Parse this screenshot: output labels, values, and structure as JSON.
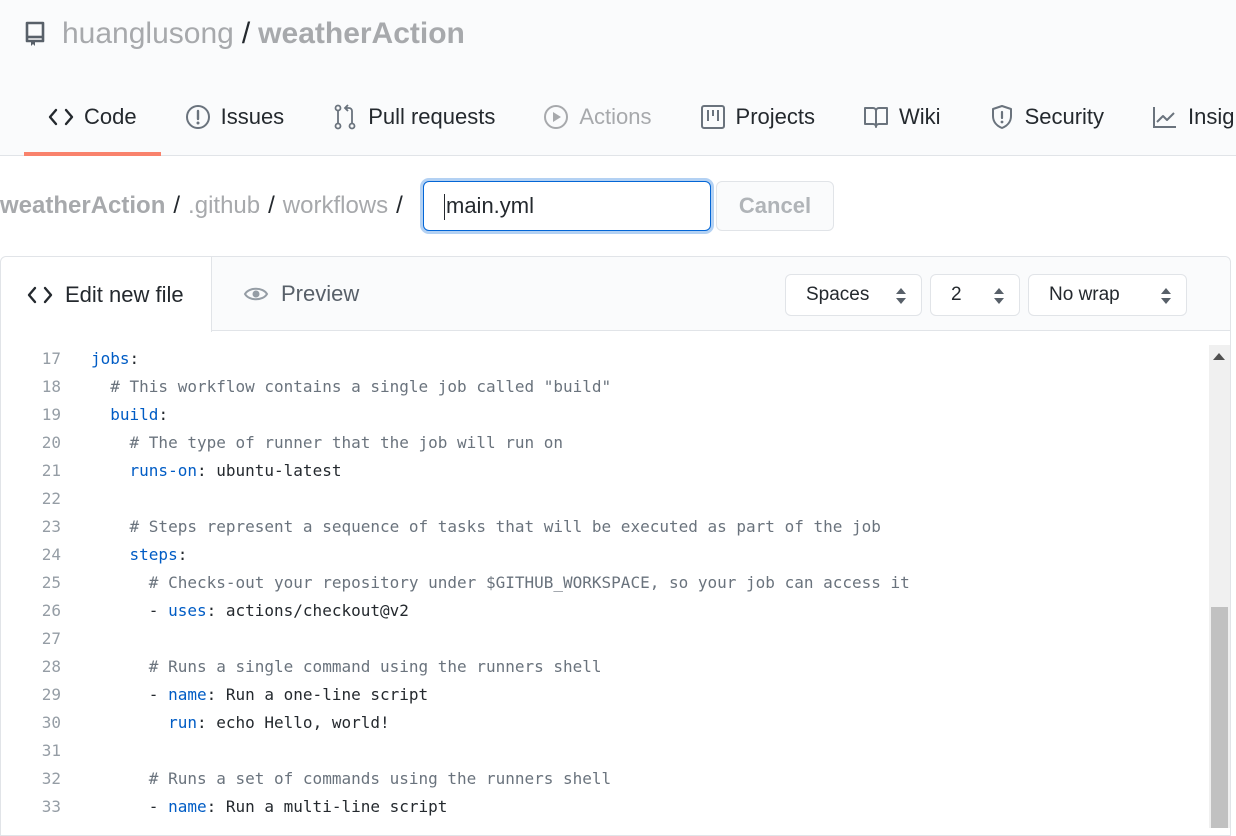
{
  "repo": {
    "owner": "huanglusong",
    "separator": "/",
    "name": "weatherAction"
  },
  "nav": {
    "tabs": [
      {
        "label": "Code",
        "icon": "code-icon",
        "selected": true
      },
      {
        "label": "Issues",
        "icon": "issue-icon"
      },
      {
        "label": "Pull requests",
        "icon": "pull-request-icon"
      },
      {
        "label": "Actions",
        "icon": "play-icon",
        "dim": true
      },
      {
        "label": "Projects",
        "icon": "project-icon"
      },
      {
        "label": "Wiki",
        "icon": "book-icon"
      },
      {
        "label": "Security",
        "icon": "shield-icon"
      },
      {
        "label": "Insig",
        "icon": "graph-icon"
      }
    ]
  },
  "breadcrumb": {
    "root": "weatherAction",
    "parts": [
      ".github",
      "workflows"
    ],
    "slash": "/"
  },
  "filename": {
    "value": "main.yml"
  },
  "cancel_label": "Cancel",
  "editor": {
    "tabs": {
      "edit": "Edit new file",
      "preview": "Preview"
    },
    "indent_mode": "Spaces",
    "indent_size": "2",
    "wrap_mode": "No wrap"
  },
  "code": {
    "lines": [
      {
        "n": "17",
        "indent": "",
        "key": "jobs",
        "rest": ":"
      },
      {
        "n": "18",
        "indent": "  ",
        "comment": "# This workflow contains a single job called \"build\""
      },
      {
        "n": "19",
        "indent": "  ",
        "key": "build",
        "rest": ":"
      },
      {
        "n": "20",
        "indent": "    ",
        "comment": "# The type of runner that the job will run on"
      },
      {
        "n": "21",
        "indent": "    ",
        "key": "runs-on",
        "rest": ": ubuntu-latest"
      },
      {
        "n": "22",
        "indent": ""
      },
      {
        "n": "23",
        "indent": "    ",
        "comment": "# Steps represent a sequence of tasks that will be executed as part of the job"
      },
      {
        "n": "24",
        "indent": "    ",
        "key": "steps",
        "rest": ":"
      },
      {
        "n": "25",
        "indent": "      ",
        "comment": "# Checks-out your repository under $GITHUB_WORKSPACE, so your job can access it"
      },
      {
        "n": "26",
        "indent": "      - ",
        "key": "uses",
        "rest": ": actions/checkout@v2"
      },
      {
        "n": "27",
        "indent": ""
      },
      {
        "n": "28",
        "indent": "      ",
        "comment": "# Runs a single command using the runners shell"
      },
      {
        "n": "29",
        "indent": "      - ",
        "key": "name",
        "rest": ": Run a one-line script"
      },
      {
        "n": "30",
        "indent": "        ",
        "key": "run",
        "rest": ": echo Hello, world!"
      },
      {
        "n": "31",
        "indent": ""
      },
      {
        "n": "32",
        "indent": "      ",
        "comment": "# Runs a set of commands using the runners shell"
      },
      {
        "n": "33",
        "indent": "      - ",
        "key": "name",
        "rest": ": Run a multi-line script"
      }
    ]
  },
  "colors": {
    "accent_tab": "#f9826c",
    "focus": "#0366d6",
    "yaml_key": "#005cc5",
    "comment": "#6a737d"
  }
}
